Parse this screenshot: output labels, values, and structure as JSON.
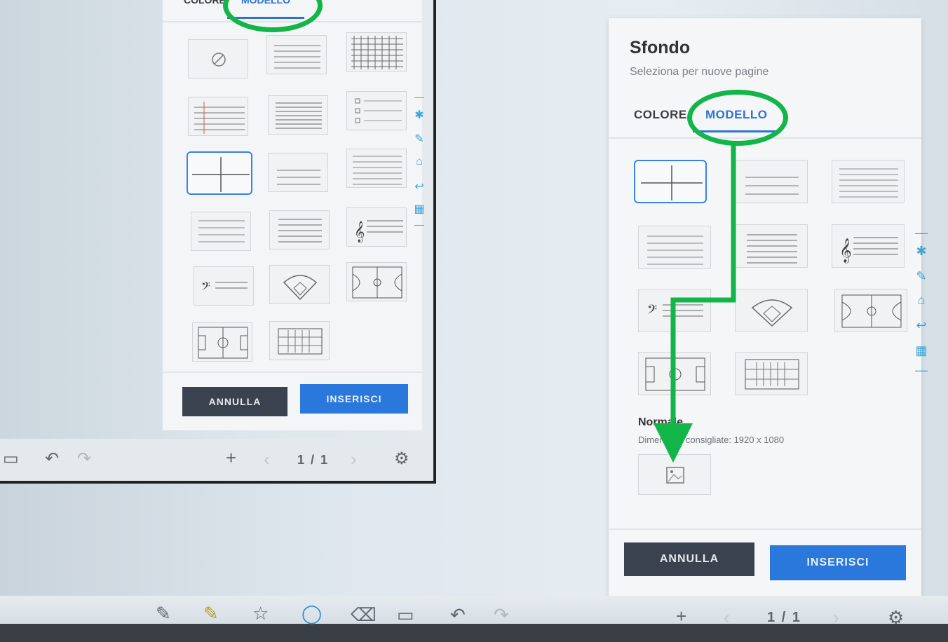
{
  "dialog": {
    "title": "Sfondo",
    "subtitle": "Seleziona per nuove pagine",
    "tabs": [
      "COLORE",
      "MODELLO"
    ],
    "active_tab": "MODELLO",
    "section_normal_label": "Normale",
    "section_normal_hint": "Dimensioni consigliate: 1920 x 1080",
    "cancel_label": "ANNULLA",
    "insert_label": "INSERISCI"
  },
  "inset_dialog": {
    "tabs": [
      "COLORE",
      "MODELLO"
    ],
    "cancel_label": "ANNULLA",
    "insert_label": "INSERISCI"
  },
  "toolbar": {
    "page_indicator": "1 / 1",
    "inset_page_indicator": "1 / 1",
    "icons": [
      "pen-icon",
      "highlighter-icon",
      "star-icon",
      "lasso-icon",
      "eraser-icon",
      "presenter-icon",
      "undo-icon",
      "redo-icon",
      "add-page-icon",
      "prev-page-icon",
      "next-page-icon",
      "settings-icon"
    ]
  },
  "side_toolbar": {
    "icons": [
      "dash-icon",
      "brush-icon",
      "pen-icon",
      "home-icon",
      "back-icon",
      "grid-icon",
      "dash-icon"
    ]
  },
  "templates": [
    "blank",
    "lines",
    "grid",
    "margin-lines",
    "dense-lines",
    "checklist",
    "quadrants",
    "wide-lines",
    "ruled-lines",
    "narrow-lines",
    "staff-lines",
    "treble-staff",
    "bass-staff",
    "baseball-field",
    "basketball-court",
    "soccer-field",
    "abacus"
  ],
  "colors": {
    "accent": "#2a78dc",
    "annotation": "#12b548",
    "cancel_button": "#3a4250"
  }
}
